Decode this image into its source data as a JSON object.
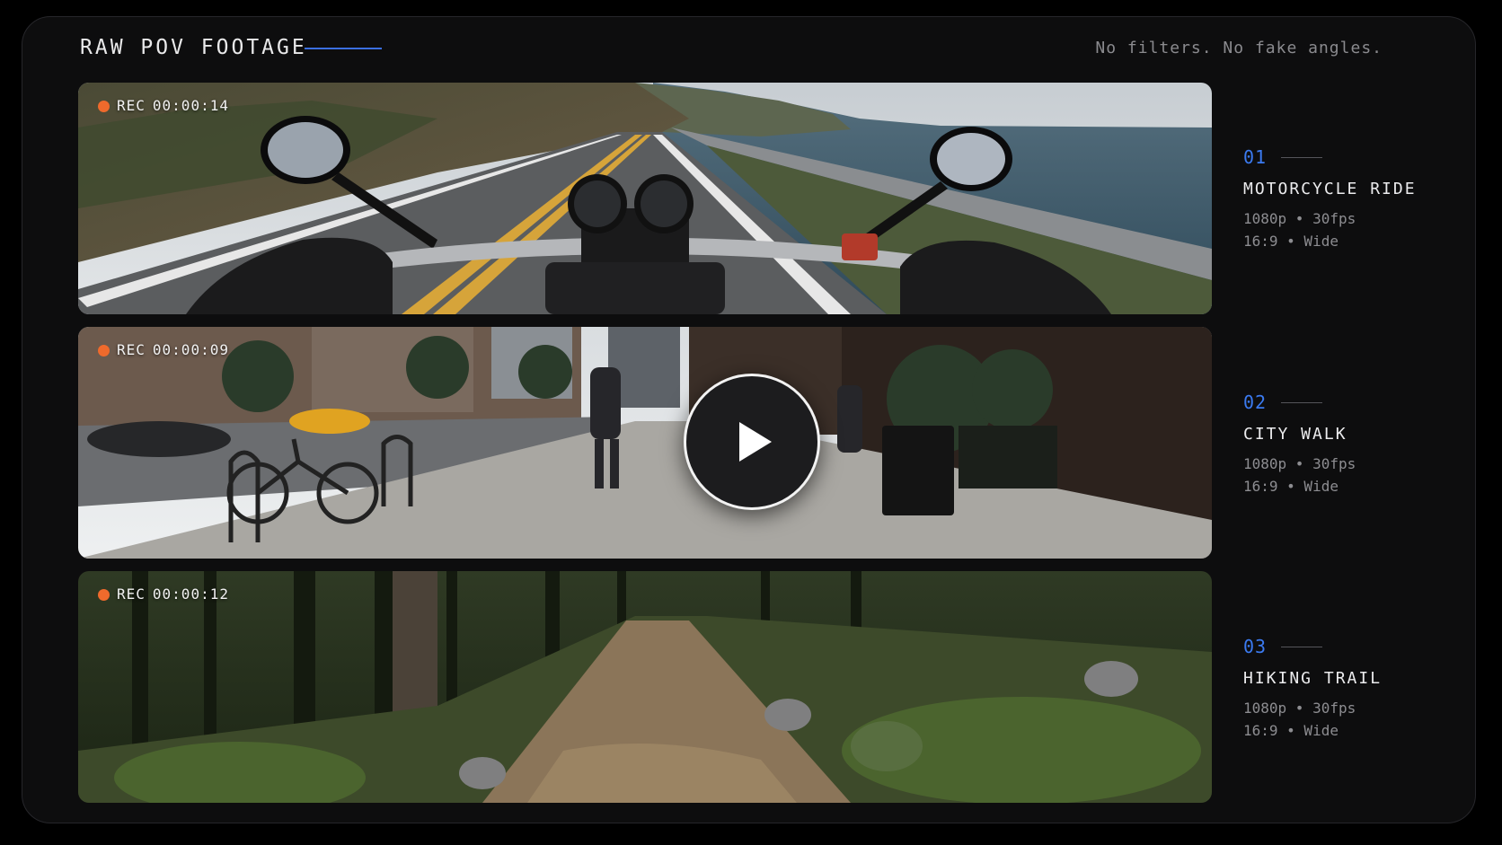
{
  "header": {
    "title": "RAW POV FOOTAGE",
    "tagline": "No filters. No fake angles."
  },
  "accent_color": "#3b6fe0",
  "rec_color": "#ef6a2c",
  "clips": [
    {
      "rec_label": "REC",
      "timecode": "00:00:14",
      "number": "01",
      "title": "MOTORCYCLE RIDE",
      "resolution": "1080p",
      "framerate": "30fps",
      "aspect": "16:9",
      "lens": "Wide",
      "meta_line1": "1080p • 30fps",
      "meta_line2": "16:9 • Wide"
    },
    {
      "rec_label": "REC",
      "timecode": "00:00:09",
      "number": "02",
      "title": "CITY WALK",
      "resolution": "1080p",
      "framerate": "30fps",
      "aspect": "16:9",
      "lens": "Wide",
      "meta_line1": "1080p • 30fps",
      "meta_line2": "16:9 • Wide",
      "play_icon": "play-icon"
    },
    {
      "rec_label": "REC",
      "timecode": "00:00:12",
      "number": "03",
      "title": "HIKING TRAIL",
      "resolution": "1080p",
      "framerate": "30fps",
      "aspect": "16:9",
      "lens": "Wide",
      "meta_line1": "1080p • 30fps",
      "meta_line2": "16:9 • Wide"
    }
  ]
}
